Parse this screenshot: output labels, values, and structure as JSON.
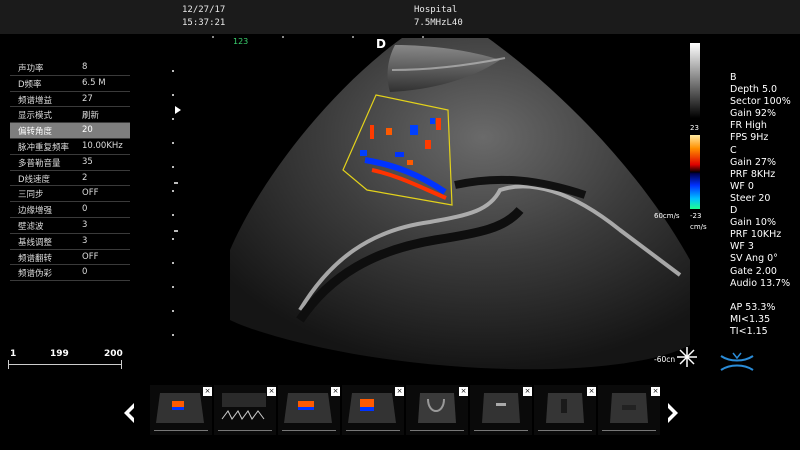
{
  "header": {
    "date": "12/27/17",
    "time": "15:37:21",
    "institution": "Hospital",
    "probe": "7.5MHzL40"
  },
  "image": {
    "frame_counter": "123",
    "orientation_mark": "D"
  },
  "params": [
    {
      "label": "声功率",
      "value": "8"
    },
    {
      "label": "D频率",
      "value": "6.5 M"
    },
    {
      "label": "频谱增益",
      "value": "27"
    },
    {
      "label": "显示模式",
      "value": "刷新"
    },
    {
      "label": "偏转角度",
      "value": "20",
      "selected": true
    },
    {
      "label": "脉冲重复频率",
      "value": "10.00KHz"
    },
    {
      "label": "多普勒音量",
      "value": "35"
    },
    {
      "label": "D线速度",
      "value": "2"
    },
    {
      "label": "三同步",
      "value": "OFF"
    },
    {
      "label": "边缘增强",
      "value": "0"
    },
    {
      "label": "壁滤波",
      "value": "3"
    },
    {
      "label": "基线调整",
      "value": "3"
    },
    {
      "label": "频谱翻转",
      "value": "OFF"
    },
    {
      "label": "频谱伪彩",
      "value": "0"
    }
  ],
  "range": {
    "start": "1",
    "current": "199",
    "end": "200"
  },
  "colorbar": {
    "top": "23",
    "bottom": "-23",
    "unit": "cm/s",
    "scale": "60cm/s"
  },
  "right_params": [
    "B",
    "Depth 5.0",
    "Sector 100%",
    "Gain 92%",
    "FR High",
    "FPS 9Hz",
    "C",
    "Gain  27%",
    "PRF 8KHz",
    "WF 0",
    "Steer 20",
    "D",
    "Gain  10%",
    "PRF 10KHz",
    "WF 3",
    "SV Ang 0°",
    "Gate 2.00",
    "Audio 13.7%",
    "",
    "AP 53.3%",
    "MI<1.35",
    "TI<1.15"
  ],
  "freeze": {
    "label": "-60cn"
  },
  "thumbnails": [
    {
      "type": "color-doppler"
    },
    {
      "type": "spectral"
    },
    {
      "type": "color-doppler"
    },
    {
      "type": "color-doppler"
    },
    {
      "type": "b-mode"
    },
    {
      "type": "b-mode"
    },
    {
      "type": "b-mode"
    },
    {
      "type": "b-mode"
    }
  ]
}
